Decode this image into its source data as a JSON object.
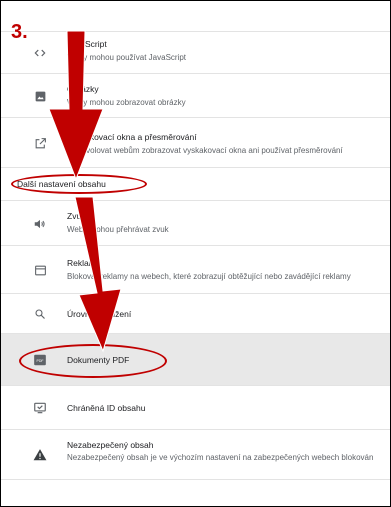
{
  "step_label": "3.",
  "rows": [
    {
      "title": "JavaScript",
      "desc": "Weby mohou používat JavaScript",
      "icon": "code-icon"
    },
    {
      "title": "Obrázky",
      "desc": "Weby mohou zobrazovat obrázky",
      "icon": "image-icon"
    },
    {
      "title": "Vyskakovací okna a přesměrování",
      "desc": "Nepovolovat webům zobrazovat vyskakovací okna ani používat přesměrování",
      "icon": "open-in-new-icon"
    }
  ],
  "section_label": "Další nastavení obsahu",
  "rows2": [
    {
      "title": "Zvuk",
      "desc": "Weby mohou přehrávat zvuk",
      "icon": "volume-icon"
    },
    {
      "title": "Reklamy",
      "desc": "Blokovat reklamy na webech, které zobrazují obtěžující nebo zavádějící reklamy",
      "icon": "ads-icon"
    },
    {
      "title": "Úrovně přiblížení",
      "icon": "search-icon"
    },
    {
      "title": "Dokumenty PDF",
      "icon": "pdf-icon",
      "selected": true
    },
    {
      "title": "Chráněná ID obsahu",
      "icon": "protected-content-icon"
    },
    {
      "title": "Nezabezpečený obsah",
      "desc": "Nezabezpečený obsah je ve výchozím nastavení na zabezpečených webech blokován",
      "icon": "warning-icon"
    }
  ],
  "colors": {
    "annotation": "#c00000",
    "selected_row": "#e8e8e8"
  }
}
